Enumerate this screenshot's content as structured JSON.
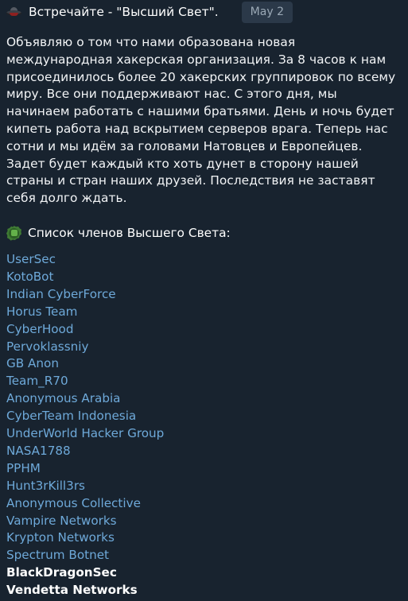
{
  "message": {
    "header": {
      "icon": "flying-saucer-emoji",
      "title": "Встречайте - \"Высший Свет\".",
      "date_badge": "May 2"
    },
    "body_text": "Объявляю о том что нами образована новая международная хакерская организация. За 8 часов к нам присоединилось более 20 хакерских группировок по всему миру. Все они поддерживают нас. С этого дня, мы начинаем работать с нашими братьями. День и ночь будет кипеть работа над вскрытием серверов врага. Теперь нас сотни и мы идём за головами Натовцев и Европейцев. Задет будет каждый кто хоть дунет в сторону нашей страны и стран наших друзей. Последствия не заставят себя долго ждать.",
    "list_heading": {
      "icon": "green-rosette-emoji",
      "text": "Список членов Высшего Света:"
    },
    "members": [
      {
        "name": "UserSec",
        "is_link": true
      },
      {
        "name": "KotoBot",
        "is_link": true
      },
      {
        "name": "Indian CyberForce",
        "is_link": true
      },
      {
        "name": "Horus Team",
        "is_link": true
      },
      {
        "name": "CyberHood",
        "is_link": true
      },
      {
        "name": "Pervoklassniy",
        "is_link": true
      },
      {
        "name": "GB Anon",
        "is_link": true
      },
      {
        "name": "Team_R70",
        "is_link": true
      },
      {
        "name": "Anonymous Arabia",
        "is_link": true
      },
      {
        "name": "CyberTeam Indonesia",
        "is_link": true
      },
      {
        "name": "UnderWorld Hacker Group",
        "is_link": true
      },
      {
        "name": "NASA1788",
        "is_link": true
      },
      {
        "name": "PPHM",
        "is_link": true
      },
      {
        "name": "Hunt3rKill3rs",
        "is_link": true
      },
      {
        "name": "Anonymous Collective",
        "is_link": true
      },
      {
        "name": "Vampire Networks",
        "is_link": true
      },
      {
        "name": "Krypton Networks",
        "is_link": true
      },
      {
        "name": "Spectrum Botnet",
        "is_link": true
      },
      {
        "name": "BlackDragonSec",
        "is_link": false
      },
      {
        "name": "Vendetta Networks",
        "is_link": false
      }
    ]
  },
  "colors": {
    "background": "#18232f",
    "text": "#ffffff",
    "link": "#6ea9d9",
    "badge_background": "#2b3949",
    "badge_text": "#9aa8b5"
  }
}
